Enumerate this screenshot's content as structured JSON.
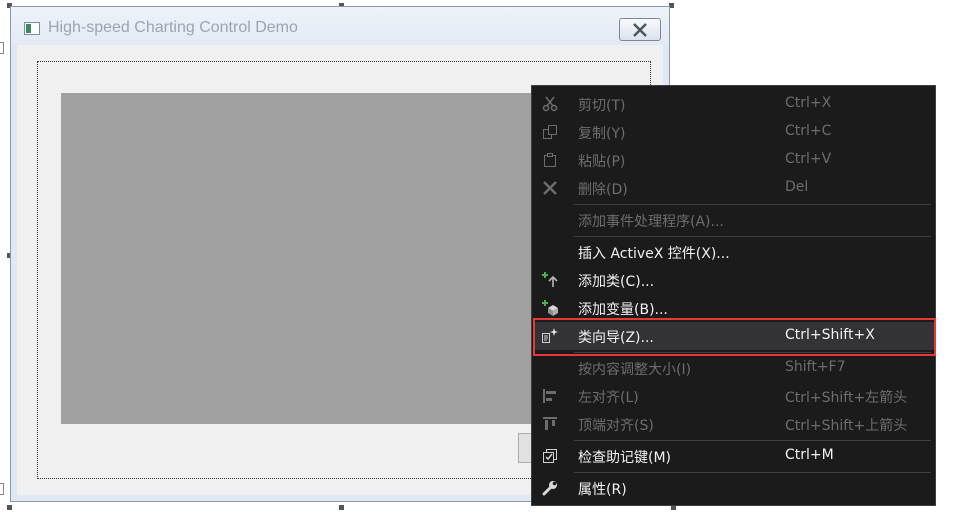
{
  "dialog": {
    "title": "High-speed Charting Control Demo",
    "close_icon": "close-icon"
  },
  "menu": {
    "items": [
      {
        "label": "剪切(T)",
        "shortcut": "Ctrl+X",
        "icon": "scissors-icon",
        "enabled": false
      },
      {
        "label": "复制(Y)",
        "shortcut": "Ctrl+C",
        "icon": "copy-icon",
        "enabled": false
      },
      {
        "label": "粘贴(P)",
        "shortcut": "Ctrl+V",
        "icon": "paste-icon",
        "enabled": false
      },
      {
        "label": "删除(D)",
        "shortcut": "Del",
        "icon": "delete-icon",
        "enabled": false
      },
      {
        "label": "添加事件处理程序(A)...",
        "shortcut": "",
        "icon": "",
        "enabled": false
      },
      {
        "label": "插入 ActiveX 控件(X)...",
        "shortcut": "",
        "icon": "",
        "enabled": true
      },
      {
        "label": "添加类(C)...",
        "shortcut": "",
        "icon": "add-class-icon",
        "enabled": true
      },
      {
        "label": "添加变量(B)...",
        "shortcut": "",
        "icon": "add-variable-icon",
        "enabled": true
      },
      {
        "label": "类向导(Z)...",
        "shortcut": "Ctrl+Shift+X",
        "icon": "class-wizard-icon",
        "enabled": true,
        "selected": true
      },
      {
        "label": "按内容调整大小(I)",
        "shortcut": "Shift+F7",
        "icon": "",
        "enabled": false
      },
      {
        "label": "左对齐(L)",
        "shortcut": "Ctrl+Shift+左箭头",
        "icon": "align-left-icon",
        "enabled": false
      },
      {
        "label": "顶端对齐(S)",
        "shortcut": "Ctrl+Shift+上箭头",
        "icon": "align-top-icon",
        "enabled": false
      },
      {
        "label": "检查助记键(M)",
        "shortcut": "Ctrl+M",
        "icon": "check-mnemonics-icon",
        "enabled": true
      },
      {
        "label": "属性(R)",
        "shortcut": "",
        "icon": "wrench-icon",
        "enabled": true
      }
    ]
  },
  "colors": {
    "menu_bg": "#1b1b1c",
    "highlight": "#e53935",
    "chart_placeholder": "#a0a0a0"
  }
}
